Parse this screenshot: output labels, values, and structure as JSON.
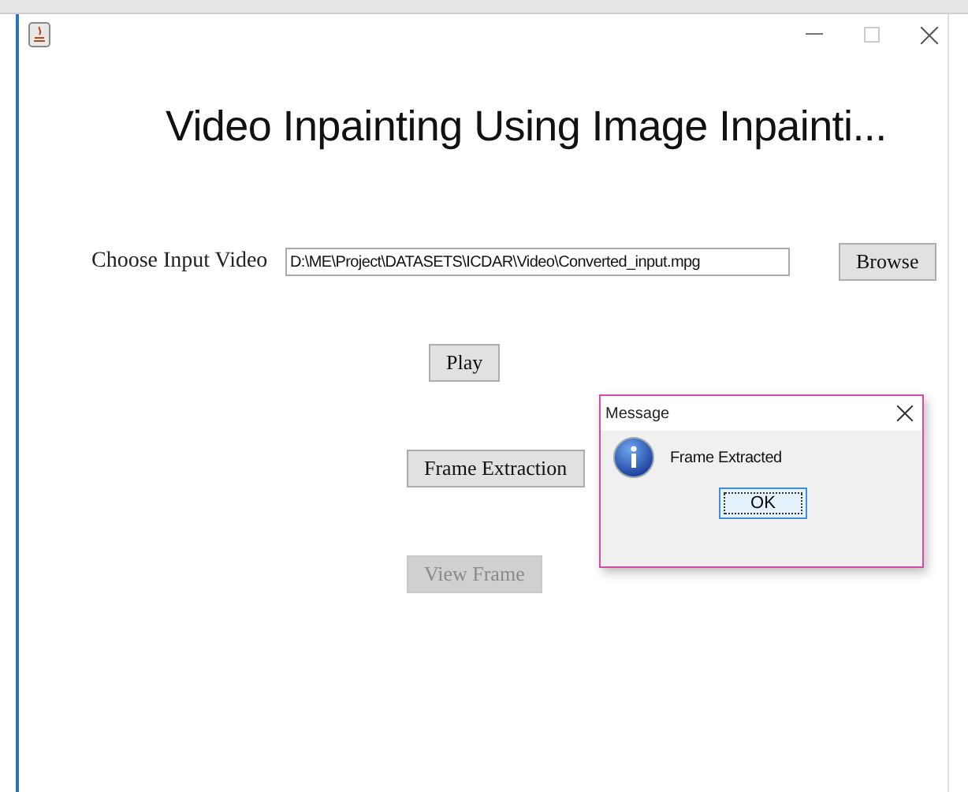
{
  "heading": "Video Inpainting Using Image Inpainti...",
  "input": {
    "label": "Choose Input Video",
    "value": "D:\\ME\\Project\\DATASETS\\ICDAR\\Video\\Converted_input.mpg",
    "button": "Browse"
  },
  "actions": [
    {
      "label": "Play",
      "disabled": false
    },
    {
      "label": "Frame Extraction",
      "disabled": false
    },
    {
      "label": "View Frame",
      "disabled": true
    }
  ],
  "dialog": {
    "title": "Message",
    "message": "Frame Extracted",
    "button": "OK"
  }
}
